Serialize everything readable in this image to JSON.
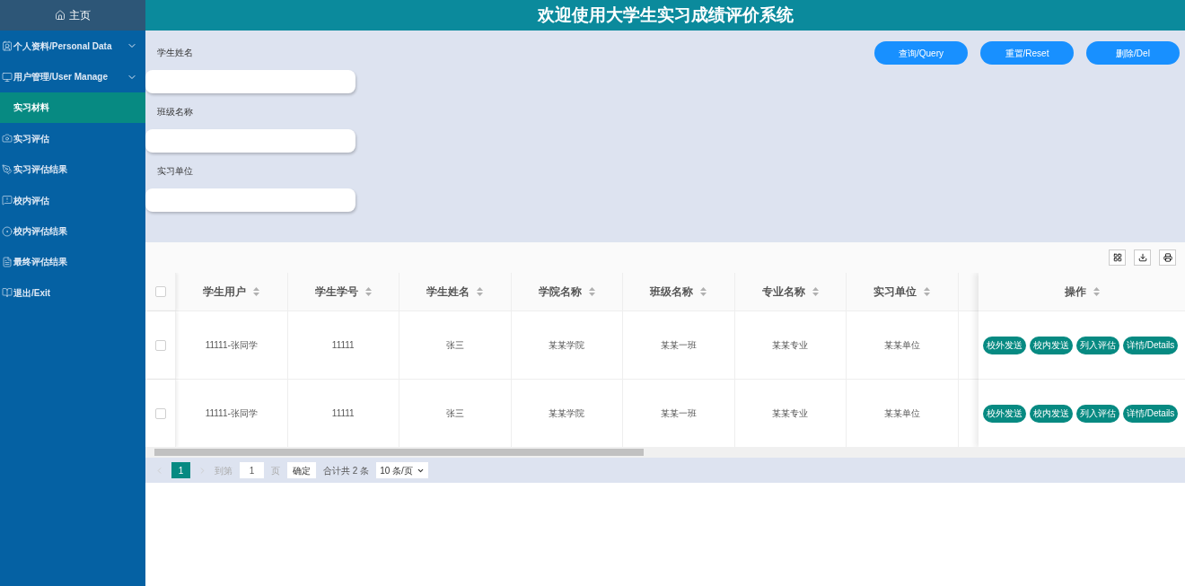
{
  "sidebar": {
    "home": "主页",
    "items": [
      {
        "label": "个人资料/Personal Data",
        "kind": "group",
        "expanded": false,
        "selected": false
      },
      {
        "label": "用户管理/User Manage",
        "kind": "group",
        "expanded": false,
        "selected": false
      },
      {
        "label": "实习材料",
        "kind": "link",
        "selected": true
      },
      {
        "label": "实习评估",
        "kind": "link",
        "selected": false
      },
      {
        "label": "实习评估结果",
        "kind": "link",
        "selected": false
      },
      {
        "label": "校内评估",
        "kind": "link",
        "selected": false
      },
      {
        "label": "校内评估结果",
        "kind": "link",
        "selected": false
      },
      {
        "label": "最终评估结果",
        "kind": "link",
        "selected": false
      },
      {
        "label": "退出/Exit",
        "kind": "link",
        "selected": false
      }
    ]
  },
  "header": {
    "title": "欢迎使用大学生实习成绩评价系统"
  },
  "search": {
    "fields": [
      {
        "label": "学生姓名"
      },
      {
        "label": "班级名称"
      },
      {
        "label": "实习单位"
      }
    ],
    "buttons": [
      "查询/Query",
      "重置/Reset",
      "删除/Del"
    ]
  },
  "table": {
    "columns": [
      "学生用户",
      "学生学号",
      "学生姓名",
      "学院名称",
      "班级名称",
      "专业名称",
      "实习单位"
    ],
    "actions_column": "操作",
    "select_all_checked": false,
    "rows": [
      {
        "checked": false,
        "cells": [
          "11111-张同学",
          "11111",
          "张三",
          "某某学院",
          "某某一班",
          "某某专业",
          "某某单位"
        ],
        "actions": [
          "校外发送",
          "校内发送",
          "列入评估",
          "详情/Details"
        ]
      },
      {
        "checked": false,
        "cells": [
          "11111-张同学",
          "11111",
          "张三",
          "某某学院",
          "某某一班",
          "某某专业",
          "某某单位"
        ],
        "actions": [
          "校外发送",
          "校内发送",
          "列入评估",
          "详情/Details"
        ]
      }
    ]
  },
  "pagination": {
    "pages": [
      {
        "label": "1",
        "selected": true
      }
    ],
    "goto_label": "到第",
    "goto_value": "1",
    "page_unit": "页",
    "confirm": "确定",
    "total": "合计共 2 条",
    "page_size": "10 条/页"
  }
}
